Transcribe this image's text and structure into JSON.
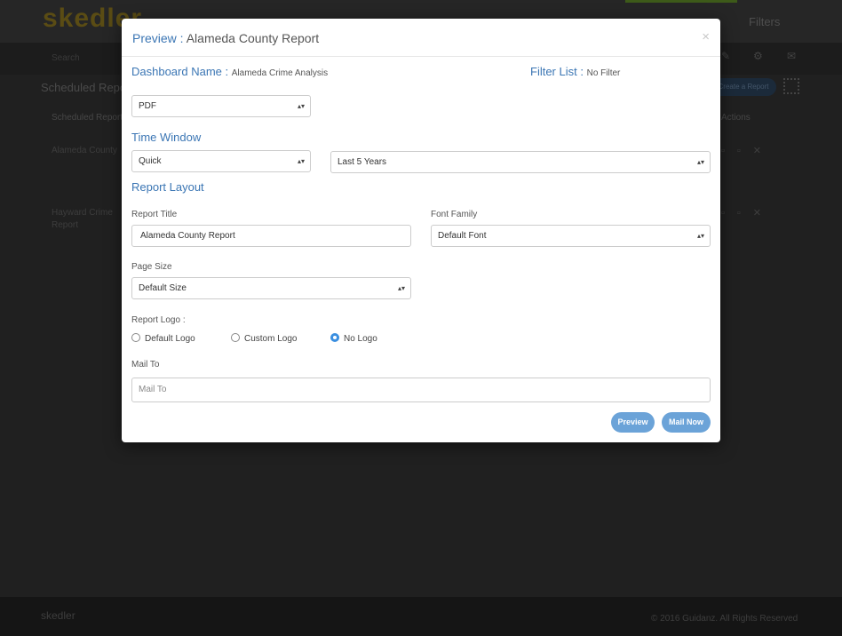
{
  "background_app": {
    "brand": "skedler",
    "nav": {
      "filters": "Filters"
    },
    "search_placeholder": "Search",
    "section_title": "Scheduled Reports",
    "create_button": "Create a Report",
    "columns": {
      "scheduled_report": "Scheduled Report",
      "actions": "Actions"
    },
    "rows": [
      {
        "name": "Alameda County"
      },
      {
        "name_line1": "Hayward Crime",
        "name_line2": "Report"
      }
    ],
    "footer": {
      "brand": "skedler",
      "copyright": "© 2016 Guidanz. All Rights Reserved"
    }
  },
  "modal": {
    "title_prefix": "Preview :",
    "title_value": "Alameda County Report",
    "close_glyph": "×",
    "dashboard_name": {
      "label": "Dashboard Name :",
      "value": "Alameda Crime Analysis"
    },
    "filter_list": {
      "label": "Filter List :",
      "value": "No Filter"
    },
    "format_select": {
      "value": "PDF"
    },
    "time_window": {
      "heading": "Time Window",
      "mode_select": "Quick",
      "range_select": "Last 5 Years"
    },
    "report_layout": {
      "heading": "Report Layout",
      "report_title": {
        "label": "Report Title",
        "value": "Alameda County Report"
      },
      "font_family": {
        "label": "Font Family",
        "value": "Default Font"
      },
      "page_size": {
        "label": "Page Size",
        "value": "Default Size"
      },
      "report_logo": {
        "label": "Report Logo :",
        "options": [
          "Default Logo",
          "Custom Logo",
          "No Logo"
        ],
        "selected": "No Logo"
      }
    },
    "mail_to": {
      "label": "Mail To",
      "placeholder": "Mail To",
      "value": ""
    },
    "buttons": {
      "preview": "Preview",
      "mail_now": "Mail Now"
    },
    "colors": {
      "accent": "#3b76b4",
      "button": "#6ba3d8",
      "radio_checked": "#3b8fe0"
    }
  }
}
